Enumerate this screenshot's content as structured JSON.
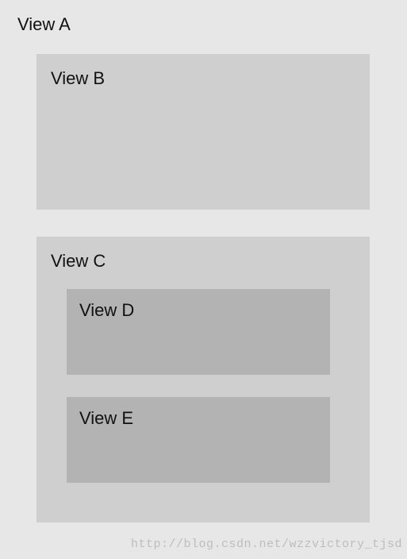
{
  "viewA": {
    "label": "View A"
  },
  "viewB": {
    "label": "View B"
  },
  "viewC": {
    "label": "View C"
  },
  "viewD": {
    "label": "View D"
  },
  "viewE": {
    "label": "View E"
  },
  "watermark": "http://blog.csdn.net/wzzvictory_tjsd"
}
